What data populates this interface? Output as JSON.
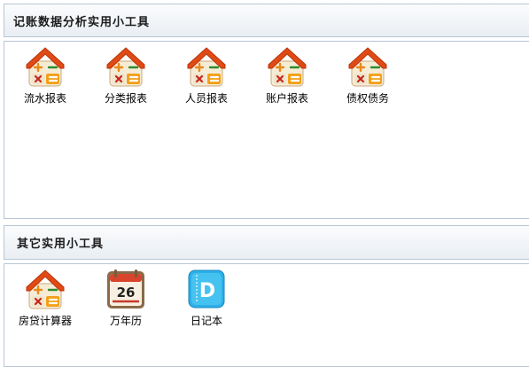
{
  "section1": {
    "title": "记账数据分析实用小工具",
    "tools": [
      {
        "label": "流水报表",
        "icon": "calculator-house-icon"
      },
      {
        "label": "分类报表",
        "icon": "calculator-house-icon"
      },
      {
        "label": "人员报表",
        "icon": "calculator-house-icon"
      },
      {
        "label": "账户报表",
        "icon": "calculator-house-icon"
      },
      {
        "label": "债权债务",
        "icon": "calculator-house-icon"
      }
    ]
  },
  "section2": {
    "title": "其它实用小工具",
    "tools": [
      {
        "label": "房贷计算器",
        "icon": "calculator-house-icon"
      },
      {
        "label": "万年历",
        "icon": "calendar-icon",
        "icon_text": "26"
      },
      {
        "label": "日记本",
        "icon": "diary-icon",
        "icon_text": "D"
      }
    ]
  },
  "colors": {
    "roof": "#e04a14",
    "accent_orange": "#f08c1e",
    "panel_border": "#b7c6d6",
    "diary_blue": "#2bb0e8"
  }
}
